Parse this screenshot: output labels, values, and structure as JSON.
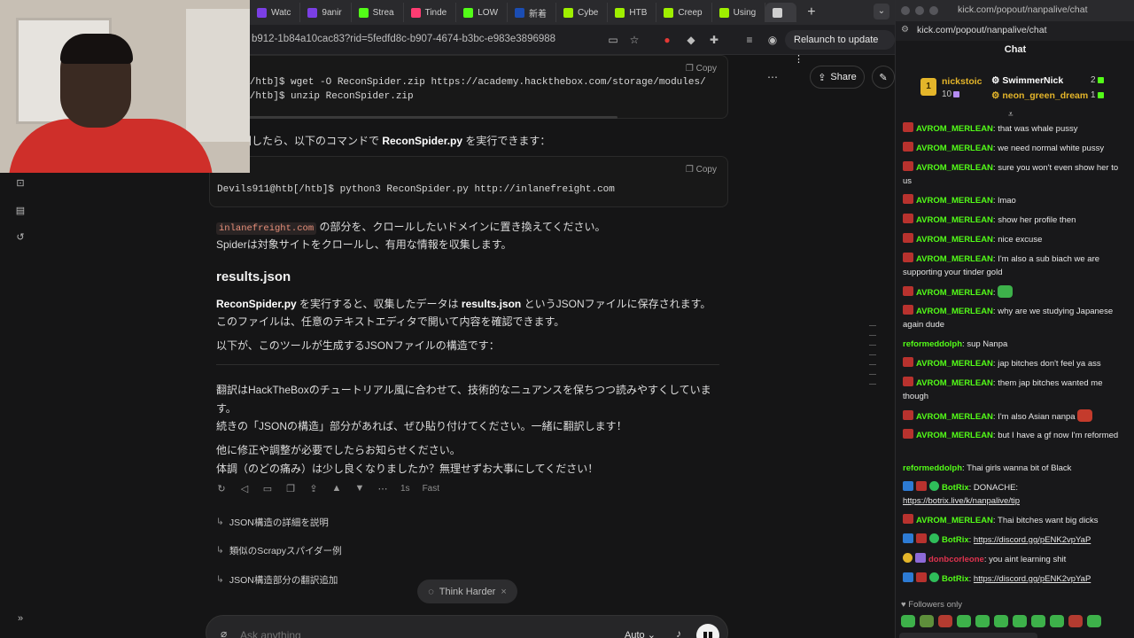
{
  "browser": {
    "tabs": [
      {
        "label": "Watc",
        "color": "#7b3fe4"
      },
      {
        "label": "9anir",
        "color": "#7b3fe4"
      },
      {
        "label": "Strea",
        "color": "#53fc18"
      },
      {
        "label": "Tinde",
        "color": "#fe3c72"
      },
      {
        "label": "LOW",
        "color": "#53fc18"
      },
      {
        "label": "新着",
        "color": "#1b4db3"
      },
      {
        "label": "Cybe",
        "color": "#9fef00"
      },
      {
        "label": "HTB",
        "color": "#9fef00"
      },
      {
        "label": "Creep",
        "color": "#9fef00"
      },
      {
        "label": "Using",
        "color": "#9fef00"
      },
      {
        "label": "",
        "color": "#cfcfcf"
      }
    ],
    "url": "b912-1b84a10cac83?rid=5fedfd8c-b907-4674-b3bc-e983e3896988",
    "relaunch_label": "Relaunch to update"
  },
  "content": {
    "code1": {
      "label": "ession",
      "copy": "Copy",
      "lines": [
        "911@htb[/htb]$ wget -O ReconSpider.zip https://academy.hackthebox.com/storage/modules/",
        "911@htb[/htb]$ unzip ReconSpider.zip"
      ]
    },
    "para_run_prefix": "ルを展開したら、以下のコマンドで ",
    "para_run_bold": "ReconSpider.py",
    "para_run_suffix": " を実行できます：",
    "code2": {
      "label": "ession",
      "copy": "Copy",
      "lines": [
        "Devils911@htb[/htb]$ python3 ReconSpider.py http://inlanefreight.com"
      ]
    },
    "para_domain_code": "inlanefreight.com",
    "para_domain_text": " の部分を、クロールしたいドメインに置き換えてください。",
    "para_spider": "Spiderは対象サイトをクロールし、有用な情報を収集します。",
    "heading_results": "results.json",
    "para_results_b1": "ReconSpider.py",
    "para_results_t1": " を実行すると、収集したデータは ",
    "para_results_b2": "results.json",
    "para_results_t2": " というJSONファイルに保存されます。",
    "para_editor": "このファイルは、任意のテキストエディタで開いて内容を確認できます。",
    "para_structure": "以下が、このツールが生成するJSONファイルの構造です：",
    "para_translation_1": "翻訳はHackTheBoxのチュートリアル風に合わせて、技術的なニュアンスを保ちつつ読みやすくしていま",
    "para_translation_2": "す。",
    "para_paste": "続きの「JSONの構造」部分があれば、ぜひ貼り付けてください。一緒に翻訳します！",
    "para_fix": "他に修正や調整が必要でしたらお知らせください。",
    "para_health": "体調（のどの痛み）は少し良くなりましたか？無理せずお大事にしてください！",
    "response_time": "1s",
    "response_mode": "Fast",
    "followups": [
      "JSON構造の詳細を説明",
      "類似のScrapyスパイダー例",
      "JSON構造部分の翻訳追加"
    ],
    "think_harder": "Think Harder",
    "ask_placeholder": "Ask anything",
    "auto_label": "Auto",
    "share_label": "Share"
  },
  "chat": {
    "window_title": "kick.com/popout/nanpalive/chat",
    "url": "kick.com/popout/nanpalive/chat",
    "header": "Chat",
    "leaderboard": {
      "first": {
        "name": "nickstoic",
        "count": "10",
        "color": "#e4b52a"
      },
      "second": {
        "name": "SwimmerNick",
        "count": "2",
        "color": "#ffffff"
      },
      "third": {
        "name": "neon_green_dream",
        "count": "1",
        "color": "#e4b52a"
      }
    },
    "messages": [
      {
        "user": "AVROM_MERLEAN",
        "text": "that was whale pussy",
        "color": "#53fc18",
        "badges": [
          "red"
        ]
      },
      {
        "user": "AVROM_MERLEAN",
        "text": "we need normal white pussy",
        "color": "#53fc18",
        "badges": [
          "red"
        ]
      },
      {
        "user": "AVROM_MERLEAN",
        "text": "sure you won't even show her to us",
        "color": "#53fc18",
        "badges": [
          "red"
        ]
      },
      {
        "user": "AVROM_MERLEAN",
        "text": "lmao",
        "color": "#53fc18",
        "badges": [
          "red"
        ]
      },
      {
        "user": "AVROM_MERLEAN",
        "text": "show her profile then",
        "color": "#53fc18",
        "badges": [
          "red"
        ]
      },
      {
        "user": "AVROM_MERLEAN",
        "text": "nice excuse",
        "color": "#53fc18",
        "badges": [
          "red"
        ]
      },
      {
        "user": "AVROM_MERLEAN",
        "text": "I'm also a sub biach we are supporting your tinder gold",
        "color": "#53fc18",
        "badges": [
          "red"
        ]
      },
      {
        "user": "AVROM_MERLEAN",
        "text": "",
        "color": "#53fc18",
        "badges": [
          "red"
        ],
        "emote": "green"
      },
      {
        "user": "AVROM_MERLEAN",
        "text": "why are we studying Japanese again dude",
        "color": "#53fc18",
        "badges": [
          "red"
        ]
      },
      {
        "user": "reformeddolph",
        "text": "sup Nanpa",
        "color": "#53fc18",
        "badges": []
      },
      {
        "user": "AVROM_MERLEAN",
        "text": "jap bitches don't feel ya ass",
        "color": "#53fc18",
        "badges": [
          "red"
        ]
      },
      {
        "user": "AVROM_MERLEAN",
        "text": "them jap bitches wanted me though",
        "color": "#53fc18",
        "badges": [
          "red"
        ]
      },
      {
        "user": "AVROM_MERLEAN",
        "text": "I'm also Asian nanpa",
        "color": "#53fc18",
        "badges": [
          "red"
        ],
        "emote": "red"
      },
      {
        "user": "AVROM_MERLEAN",
        "text": "but I have a gf now I'm reformed",
        "color": "#53fc18",
        "badges": [
          "red"
        ]
      },
      {
        "user": "reformeddolph",
        "text": "Thai girls wanna bit of Black",
        "color": "#53fc18",
        "badges": []
      },
      {
        "user": "BotRix",
        "text": "DONACHE:",
        "link": "https://botrix.live/k/nanpalive/tip",
        "color": "#53fc18",
        "badges": [
          "blue",
          "red",
          "green"
        ]
      },
      {
        "user": "AVROM_MERLEAN",
        "text": "Thai bitches want big dicks",
        "color": "#53fc18",
        "badges": [
          "red"
        ]
      },
      {
        "user": "BotRix",
        "text": "",
        "link": "https://discord.gg/pENK2vpYaP",
        "color": "#53fc18",
        "badges": [
          "blue",
          "red",
          "green"
        ]
      },
      {
        "user": "donbcorleone",
        "text": "you aint learning shit",
        "color": "#e0334f",
        "badges": [
          "gold",
          "purple"
        ]
      },
      {
        "user": "BotRix",
        "text": "",
        "link": "https://discord.gg/pENK2vpYaP",
        "color": "#53fc18",
        "badges": [
          "blue",
          "red",
          "green"
        ]
      }
    ],
    "followers_only": "Followers only"
  }
}
